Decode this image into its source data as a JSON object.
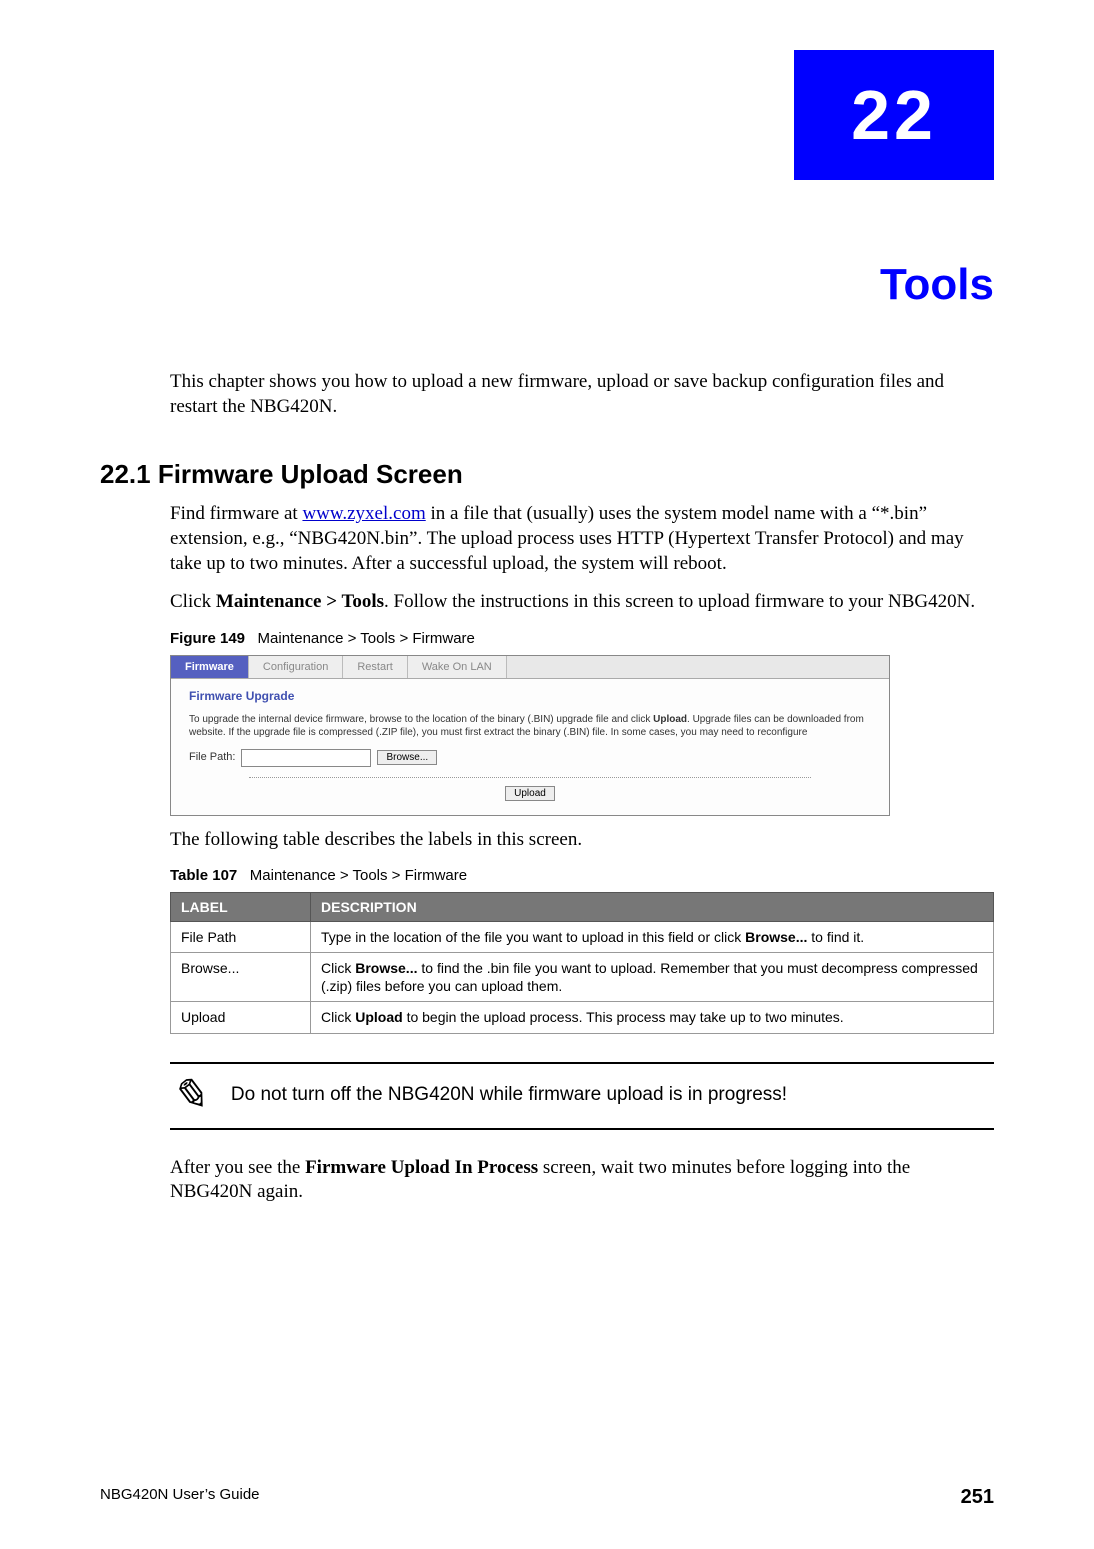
{
  "chapter": {
    "number": "22",
    "title": "Tools"
  },
  "intro": "This chapter shows you how to upload a new firmware, upload or save backup configuration files and restart the NBG420N.",
  "section": {
    "heading": "22.1  Firmware Upload Screen"
  },
  "p1_a": "Find firmware at ",
  "p1_link": "www.zyxel.com",
  "p1_b": " in a file that (usually) uses the system model name with a “*.bin” extension, e.g., “NBG420N.bin”. The upload process uses HTTP (Hypertext Transfer Protocol) and may take up to two minutes. After a successful upload, the system will reboot.",
  "p2_a": "Click ",
  "p2_b": "Maintenance > Tools",
  "p2_c": ". Follow the instructions in this screen to upload firmware to your NBG420N.",
  "figure": {
    "caption_num": "Figure 149",
    "caption_text": "Maintenance > Tools > Firmware",
    "tabs": [
      "Firmware",
      "Configuration",
      "Restart",
      "Wake On LAN"
    ],
    "subtitle": "Firmware Upgrade",
    "text_a": "To upgrade the internal device firmware, browse to the location of the binary (.BIN) upgrade file and click ",
    "text_bold": "Upload",
    "text_b": ". Upgrade files can be downloaded from website. If the upgrade file is compressed (.ZIP file), you must first extract the binary (.BIN) file. In some cases, you may need to reconfigure",
    "filepath_label": "File Path:",
    "browse_btn": "Browse...",
    "upload_btn": "Upload"
  },
  "table_intro": "The following table describes the labels in this screen.",
  "table": {
    "caption_num": "Table 107",
    "caption_text": "Maintenance > Tools > Firmware",
    "head_label": "LABEL",
    "head_desc": "DESCRIPTION",
    "rows": [
      {
        "label": "File Path",
        "d1": "Type in the location of the file you want to upload in this field or click ",
        "b1": "Browse...",
        "d2": " to find it."
      },
      {
        "label": "Browse...",
        "d1": "Click ",
        "b1": "Browse...",
        "d2": " to find the .bin file you want to upload. Remember that you must decompress compressed (.zip) files before you can upload them."
      },
      {
        "label": "Upload",
        "d1": "Click ",
        "b1": "Upload",
        "d2": " to begin the upload process. This process may take up to two minutes."
      }
    ]
  },
  "note": "Do not turn off the NBG420N while firmware upload is in progress!",
  "p3_a": "After you see the ",
  "p3_b": "Firmware Upload In Process",
  "p3_c": " screen, wait two minutes before logging into the NBG420N again.",
  "footer": {
    "guide": "NBG420N User’s Guide",
    "page": "251"
  }
}
